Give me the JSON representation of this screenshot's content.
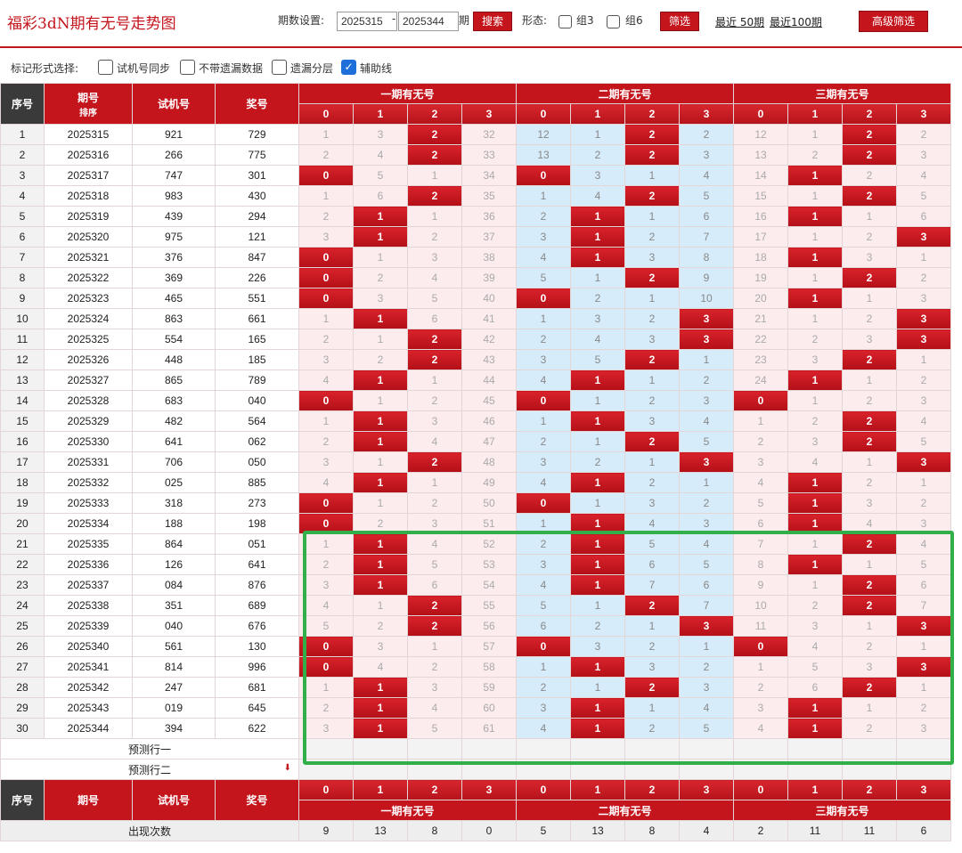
{
  "topbar": {
    "title": "福彩3dN期有无号走势图",
    "period_label": "期数设置:",
    "period_from": "2025315",
    "period_dash": "-",
    "period_to": "2025344",
    "period_unit": "期",
    "search_btn": "搜索",
    "form_label": "形态:",
    "group3_label": "组3",
    "group6_label": "组6",
    "filter_btn": "筛选",
    "recent50": "最近 50期",
    "recent100": "最近100期",
    "advanced_btn": "高级筛选"
  },
  "markbar": {
    "label": "标记形式选择:",
    "options": [
      {
        "label": "试机号同步",
        "checked": false
      },
      {
        "label": "不带遗漏数据",
        "checked": false
      },
      {
        "label": "遗漏分层",
        "checked": false
      },
      {
        "label": "辅助线",
        "checked": true
      }
    ]
  },
  "table": {
    "head": {
      "seq": "序号",
      "issue": "期号",
      "sort": "排序",
      "trial": "试机号",
      "prize": "奖号",
      "groups": [
        "一期有无号",
        "二期有无号",
        "三期有无号"
      ],
      "digits": [
        "0",
        "1",
        "2",
        "3"
      ]
    },
    "rows": [
      {
        "seq": "1",
        "issue": "2025315",
        "trial": "921",
        "prize": "729",
        "v": [
          "1",
          "3",
          "2",
          "32",
          "12",
          "1",
          "2",
          "2",
          "12",
          "1",
          "2",
          "2"
        ],
        "h": [
          0,
          0,
          1,
          0,
          0,
          0,
          1,
          0,
          0,
          0,
          1,
          0
        ]
      },
      {
        "seq": "2",
        "issue": "2025316",
        "trial": "266",
        "prize": "775",
        "v": [
          "2",
          "4",
          "2",
          "33",
          "13",
          "2",
          "2",
          "3",
          "13",
          "2",
          "2",
          "3"
        ],
        "h": [
          0,
          0,
          1,
          0,
          0,
          0,
          1,
          0,
          0,
          0,
          1,
          0
        ]
      },
      {
        "seq": "3",
        "issue": "2025317",
        "trial": "747",
        "prize": "301",
        "v": [
          "0",
          "5",
          "1",
          "34",
          "0",
          "3",
          "1",
          "4",
          "14",
          "1",
          "2",
          "4"
        ],
        "h": [
          1,
          0,
          0,
          0,
          1,
          0,
          0,
          0,
          0,
          1,
          0,
          0
        ]
      },
      {
        "seq": "4",
        "issue": "2025318",
        "trial": "983",
        "prize": "430",
        "v": [
          "1",
          "6",
          "2",
          "35",
          "1",
          "4",
          "2",
          "5",
          "15",
          "1",
          "2",
          "5"
        ],
        "h": [
          0,
          0,
          1,
          0,
          0,
          0,
          1,
          0,
          0,
          0,
          1,
          0
        ]
      },
      {
        "seq": "5",
        "issue": "2025319",
        "trial": "439",
        "prize": "294",
        "v": [
          "2",
          "1",
          "1",
          "36",
          "2",
          "1",
          "1",
          "6",
          "16",
          "1",
          "1",
          "6"
        ],
        "h": [
          0,
          1,
          0,
          0,
          0,
          1,
          0,
          0,
          0,
          1,
          0,
          0
        ]
      },
      {
        "seq": "6",
        "issue": "2025320",
        "trial": "975",
        "prize": "121",
        "v": [
          "3",
          "1",
          "2",
          "37",
          "3",
          "1",
          "2",
          "7",
          "17",
          "1",
          "2",
          "3"
        ],
        "h": [
          0,
          1,
          0,
          0,
          0,
          1,
          0,
          0,
          0,
          0,
          0,
          1
        ]
      },
      {
        "seq": "7",
        "issue": "2025321",
        "trial": "376",
        "prize": "847",
        "v": [
          "0",
          "1",
          "3",
          "38",
          "4",
          "1",
          "3",
          "8",
          "18",
          "1",
          "3",
          "1"
        ],
        "h": [
          1,
          0,
          0,
          0,
          0,
          1,
          0,
          0,
          0,
          1,
          0,
          0
        ]
      },
      {
        "seq": "8",
        "issue": "2025322",
        "trial": "369",
        "prize": "226",
        "v": [
          "0",
          "2",
          "4",
          "39",
          "5",
          "1",
          "2",
          "9",
          "19",
          "1",
          "2",
          "2"
        ],
        "h": [
          1,
          0,
          0,
          0,
          0,
          0,
          1,
          0,
          0,
          0,
          1,
          0
        ]
      },
      {
        "seq": "9",
        "issue": "2025323",
        "trial": "465",
        "prize": "551",
        "v": [
          "0",
          "3",
          "5",
          "40",
          "0",
          "2",
          "1",
          "10",
          "20",
          "1",
          "1",
          "3"
        ],
        "h": [
          1,
          0,
          0,
          0,
          1,
          0,
          0,
          0,
          0,
          1,
          0,
          0
        ]
      },
      {
        "seq": "10",
        "issue": "2025324",
        "trial": "863",
        "prize": "661",
        "v": [
          "1",
          "1",
          "6",
          "41",
          "1",
          "3",
          "2",
          "3",
          "21",
          "1",
          "2",
          "3"
        ],
        "h": [
          0,
          1,
          0,
          0,
          0,
          0,
          0,
          1,
          0,
          0,
          0,
          1
        ]
      },
      {
        "seq": "11",
        "issue": "2025325",
        "trial": "554",
        "prize": "165",
        "v": [
          "2",
          "1",
          "2",
          "42",
          "2",
          "4",
          "3",
          "3",
          "22",
          "2",
          "3",
          "3"
        ],
        "h": [
          0,
          0,
          1,
          0,
          0,
          0,
          0,
          1,
          0,
          0,
          0,
          1
        ]
      },
      {
        "seq": "12",
        "issue": "2025326",
        "trial": "448",
        "prize": "185",
        "v": [
          "3",
          "2",
          "2",
          "43",
          "3",
          "5",
          "2",
          "1",
          "23",
          "3",
          "2",
          "1"
        ],
        "h": [
          0,
          0,
          1,
          0,
          0,
          0,
          1,
          0,
          0,
          0,
          1,
          0
        ]
      },
      {
        "seq": "13",
        "issue": "2025327",
        "trial": "865",
        "prize": "789",
        "v": [
          "4",
          "1",
          "1",
          "44",
          "4",
          "1",
          "1",
          "2",
          "24",
          "1",
          "1",
          "2"
        ],
        "h": [
          0,
          1,
          0,
          0,
          0,
          1,
          0,
          0,
          0,
          1,
          0,
          0
        ]
      },
      {
        "seq": "14",
        "issue": "2025328",
        "trial": "683",
        "prize": "040",
        "v": [
          "0",
          "1",
          "2",
          "45",
          "0",
          "1",
          "2",
          "3",
          "0",
          "1",
          "2",
          "3"
        ],
        "h": [
          1,
          0,
          0,
          0,
          1,
          0,
          0,
          0,
          1,
          0,
          0,
          0
        ]
      },
      {
        "seq": "15",
        "issue": "2025329",
        "trial": "482",
        "prize": "564",
        "v": [
          "1",
          "1",
          "3",
          "46",
          "1",
          "1",
          "3",
          "4",
          "1",
          "2",
          "2",
          "4"
        ],
        "h": [
          0,
          1,
          0,
          0,
          0,
          1,
          0,
          0,
          0,
          0,
          1,
          0
        ]
      },
      {
        "seq": "16",
        "issue": "2025330",
        "trial": "641",
        "prize": "062",
        "v": [
          "2",
          "1",
          "4",
          "47",
          "2",
          "1",
          "2",
          "5",
          "2",
          "3",
          "2",
          "5"
        ],
        "h": [
          0,
          1,
          0,
          0,
          0,
          0,
          1,
          0,
          0,
          0,
          1,
          0
        ]
      },
      {
        "seq": "17",
        "issue": "2025331",
        "trial": "706",
        "prize": "050",
        "v": [
          "3",
          "1",
          "2",
          "48",
          "3",
          "2",
          "1",
          "3",
          "3",
          "4",
          "1",
          "3"
        ],
        "h": [
          0,
          0,
          1,
          0,
          0,
          0,
          0,
          1,
          0,
          0,
          0,
          1
        ]
      },
      {
        "seq": "18",
        "issue": "2025332",
        "trial": "025",
        "prize": "885",
        "v": [
          "4",
          "1",
          "1",
          "49",
          "4",
          "1",
          "2",
          "1",
          "4",
          "1",
          "2",
          "1"
        ],
        "h": [
          0,
          1,
          0,
          0,
          0,
          1,
          0,
          0,
          0,
          1,
          0,
          0
        ]
      },
      {
        "seq": "19",
        "issue": "2025333",
        "trial": "318",
        "prize": "273",
        "v": [
          "0",
          "1",
          "2",
          "50",
          "0",
          "1",
          "3",
          "2",
          "5",
          "1",
          "3",
          "2"
        ],
        "h": [
          1,
          0,
          0,
          0,
          1,
          0,
          0,
          0,
          0,
          1,
          0,
          0
        ]
      },
      {
        "seq": "20",
        "issue": "2025334",
        "trial": "188",
        "prize": "198",
        "v": [
          "0",
          "2",
          "3",
          "51",
          "1",
          "1",
          "4",
          "3",
          "6",
          "1",
          "4",
          "3"
        ],
        "h": [
          1,
          0,
          0,
          0,
          0,
          1,
          0,
          0,
          0,
          1,
          0,
          0
        ]
      },
      {
        "seq": "21",
        "issue": "2025335",
        "trial": "864",
        "prize": "051",
        "v": [
          "1",
          "1",
          "4",
          "52",
          "2",
          "1",
          "5",
          "4",
          "7",
          "1",
          "2",
          "4"
        ],
        "h": [
          0,
          1,
          0,
          0,
          0,
          1,
          0,
          0,
          0,
          0,
          1,
          0
        ]
      },
      {
        "seq": "22",
        "issue": "2025336",
        "trial": "126",
        "prize": "641",
        "v": [
          "2",
          "1",
          "5",
          "53",
          "3",
          "1",
          "6",
          "5",
          "8",
          "1",
          "1",
          "5"
        ],
        "h": [
          0,
          1,
          0,
          0,
          0,
          1,
          0,
          0,
          0,
          1,
          0,
          0
        ]
      },
      {
        "seq": "23",
        "issue": "2025337",
        "trial": "084",
        "prize": "876",
        "v": [
          "3",
          "1",
          "6",
          "54",
          "4",
          "1",
          "7",
          "6",
          "9",
          "1",
          "2",
          "6"
        ],
        "h": [
          0,
          1,
          0,
          0,
          0,
          1,
          0,
          0,
          0,
          0,
          1,
          0
        ]
      },
      {
        "seq": "24",
        "issue": "2025338",
        "trial": "351",
        "prize": "689",
        "v": [
          "4",
          "1",
          "2",
          "55",
          "5",
          "1",
          "2",
          "7",
          "10",
          "2",
          "2",
          "7"
        ],
        "h": [
          0,
          0,
          1,
          0,
          0,
          0,
          1,
          0,
          0,
          0,
          1,
          0
        ]
      },
      {
        "seq": "25",
        "issue": "2025339",
        "trial": "040",
        "prize": "676",
        "v": [
          "5",
          "2",
          "2",
          "56",
          "6",
          "2",
          "1",
          "3",
          "11",
          "3",
          "1",
          "3"
        ],
        "h": [
          0,
          0,
          1,
          0,
          0,
          0,
          0,
          1,
          0,
          0,
          0,
          1
        ]
      },
      {
        "seq": "26",
        "issue": "2025340",
        "trial": "561",
        "prize": "130",
        "v": [
          "0",
          "3",
          "1",
          "57",
          "0",
          "3",
          "2",
          "1",
          "0",
          "4",
          "2",
          "1"
        ],
        "h": [
          1,
          0,
          0,
          0,
          1,
          0,
          0,
          0,
          1,
          0,
          0,
          0
        ]
      },
      {
        "seq": "27",
        "issue": "2025341",
        "trial": "814",
        "prize": "996",
        "v": [
          "0",
          "4",
          "2",
          "58",
          "1",
          "1",
          "3",
          "2",
          "1",
          "5",
          "3",
          "3"
        ],
        "h": [
          1,
          0,
          0,
          0,
          0,
          1,
          0,
          0,
          0,
          0,
          0,
          1
        ]
      },
      {
        "seq": "28",
        "issue": "2025342",
        "trial": "247",
        "prize": "681",
        "v": [
          "1",
          "1",
          "3",
          "59",
          "2",
          "1",
          "2",
          "3",
          "2",
          "6",
          "2",
          "1"
        ],
        "h": [
          0,
          1,
          0,
          0,
          0,
          0,
          1,
          0,
          0,
          0,
          1,
          0
        ]
      },
      {
        "seq": "29",
        "issue": "2025343",
        "trial": "019",
        "prize": "645",
        "v": [
          "2",
          "1",
          "4",
          "60",
          "3",
          "1",
          "1",
          "4",
          "3",
          "1",
          "1",
          "2"
        ],
        "h": [
          0,
          1,
          0,
          0,
          0,
          1,
          0,
          0,
          0,
          1,
          0,
          0
        ]
      },
      {
        "seq": "30",
        "issue": "2025344",
        "trial": "394",
        "prize": "622",
        "v": [
          "3",
          "1",
          "5",
          "61",
          "4",
          "1",
          "2",
          "5",
          "4",
          "1",
          "2",
          "3"
        ],
        "h": [
          0,
          1,
          0,
          0,
          0,
          1,
          0,
          0,
          0,
          1,
          0,
          0
        ]
      }
    ],
    "predict_rows": [
      "预测行一",
      "预测行二"
    ],
    "foot": {
      "seq": "序号",
      "issue": "期号",
      "trial": "试机号",
      "prize": "奖号",
      "occurrences_label": "出现次数",
      "occurrences": [
        "9",
        "13",
        "8",
        "0",
        "5",
        "13",
        "8",
        "4",
        "2",
        "11",
        "11",
        "6"
      ]
    }
  },
  "colors": {
    "accent": "#c4141c",
    "pink_group": "#fdeced",
    "blue_group": "#d6ecfa",
    "highlight_box": "#31b04a"
  }
}
